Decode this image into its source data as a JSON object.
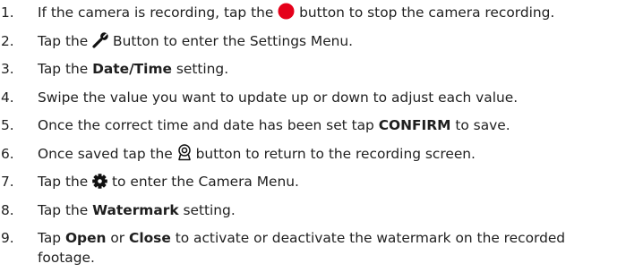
{
  "instructions": {
    "steps": [
      {
        "number": "1.",
        "pre": "If the camera is recording, tap the",
        "post": "button to stop the camera recording.",
        "icon": "record-icon",
        "icon_color": "#e5001a"
      },
      {
        "number": "2.",
        "pre": "Tap the",
        "post": "Button to enter the Settings Menu.",
        "icon": "wrench-icon"
      },
      {
        "number": "3.",
        "pre": "Tap the",
        "bold": "Date/Time",
        "post": "setting."
      },
      {
        "number": "4.",
        "text": "Swipe the value you want to update up or down to adjust each value."
      },
      {
        "number": "5.",
        "pre": "Once the correct time and date has been set tap",
        "bold": "CONFIRM",
        "post": "to save."
      },
      {
        "number": "6.",
        "pre": "Once saved tap the",
        "post": "button to return to the recording screen.",
        "icon": "webcam-icon"
      },
      {
        "number": "7.",
        "pre": "Tap the",
        "post": "to enter the Camera Menu.",
        "icon": "gear-icon"
      },
      {
        "number": "8.",
        "pre": "Tap the",
        "bold": "Watermark",
        "post": "setting."
      },
      {
        "number": "9.",
        "pre": "Tap",
        "bold1": "Open",
        "mid": "or",
        "bold2": "Close",
        "post": "to activate or deactivate the watermark on the recorded footage."
      }
    ]
  }
}
